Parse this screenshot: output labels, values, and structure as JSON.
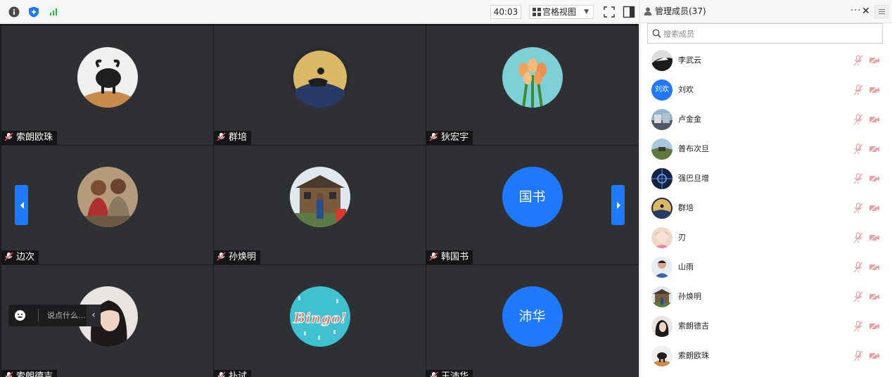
{
  "toolbar": {
    "info_icon": "info-icon",
    "shield_icon": "shield-icon",
    "signal_icon": "signal-icon",
    "timer": "40:03",
    "view_mode": "宫格视图",
    "fullscreen_icon": "fullscreen-icon",
    "layout_icon": "sidebar-layout-icon"
  },
  "grid": {
    "tiles": [
      {
        "name": "索朗欧珠",
        "avatar": "yak-photo"
      },
      {
        "name": "群培",
        "avatar": "rider-photo"
      },
      {
        "name": "狄宏宇",
        "avatar": "tulip-photo"
      },
      {
        "name": "边次",
        "avatar": "couple-photo"
      },
      {
        "name": "孙焕明",
        "avatar": "house-photo"
      },
      {
        "name": "韩国书",
        "avatar_text": "国书"
      },
      {
        "name": "索朗德吉",
        "avatar": "woman-photo"
      },
      {
        "name": "扑试",
        "avatar": "bingo-photo"
      },
      {
        "name": "王沛华",
        "avatar_text": "沛华"
      }
    ],
    "chat_placeholder": "说点什么..."
  },
  "panel": {
    "title": "管理成员(37)",
    "more": "···",
    "close": "✕",
    "search_placeholder": "搜索成员",
    "members": [
      {
        "name": "李武云",
        "avatar": "bw-photo"
      },
      {
        "name": "刘欢",
        "avatar_text": "刘欢"
      },
      {
        "name": "卢金金",
        "avatar": "street-photo"
      },
      {
        "name": "普布次旦",
        "avatar": "field-photo"
      },
      {
        "name": "强巴旦增",
        "avatar": "night-photo"
      },
      {
        "name": "群培",
        "avatar": "rider-photo"
      },
      {
        "name": "刃",
        "avatar": "girl-photo"
      },
      {
        "name": "山雨",
        "avatar": "man-photo"
      },
      {
        "name": "孙焕明",
        "avatar": "house-photo"
      },
      {
        "name": "索朗德吉",
        "avatar": "woman-photo"
      },
      {
        "name": "索朗欧珠",
        "avatar": "yak-photo"
      }
    ]
  },
  "colors": {
    "accent": "#1f79ff",
    "tile_bg": "#2f3033",
    "muted_red": "#e7a3a3"
  }
}
